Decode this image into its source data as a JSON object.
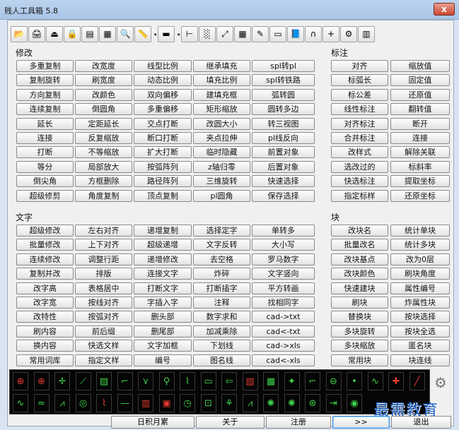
{
  "window": {
    "title": "贱人工具箱 5.8",
    "close_label": "x"
  },
  "toolbar": {
    "icons": [
      {
        "name": "open-folder-icon",
        "glyph": "📂"
      },
      {
        "name": "printer-icon",
        "glyph": "🖨"
      },
      {
        "name": "export-icon",
        "glyph": "⏏"
      },
      {
        "name": "lock-icon",
        "glyph": "🔒"
      },
      {
        "name": "plot-icon",
        "glyph": "▤"
      },
      {
        "name": "document-icon",
        "glyph": "▦"
      },
      {
        "name": "zoom-icon",
        "glyph": "🔍"
      },
      {
        "name": "ruler-icon",
        "glyph": "📏"
      },
      {
        "name": "arrow-left-icon",
        "glyph": "◂"
      },
      {
        "name": "layer-icon",
        "glyph": "▬"
      },
      {
        "name": "arrow-left-2-icon",
        "glyph": "◂"
      },
      {
        "name": "tree-icon",
        "glyph": "⊢"
      },
      {
        "name": "gradient-icon",
        "glyph": "░"
      },
      {
        "name": "resize-icon",
        "glyph": "⤢"
      },
      {
        "name": "color-palette-icon",
        "glyph": "▦"
      },
      {
        "name": "edit-doc-icon",
        "glyph": "✎"
      },
      {
        "name": "monitor-icon",
        "glyph": "▭"
      },
      {
        "name": "book-icon",
        "glyph": "📘"
      },
      {
        "name": "magnet-icon",
        "glyph": "∩"
      },
      {
        "name": "crosshair-icon",
        "glyph": "+"
      },
      {
        "name": "plugin-icon",
        "glyph": "⚙"
      },
      {
        "name": "calculator-icon",
        "glyph": "▥"
      }
    ]
  },
  "sections": {
    "modify": "修改",
    "dimension": "标注",
    "text": "文字",
    "block": "块"
  },
  "modify_buttons": [
    [
      "多重复制",
      "改宽度",
      "线型比例",
      "继承填充",
      "spl转pl"
    ],
    [
      "复制旋转",
      "刷宽度",
      "动态比例",
      "填充比例",
      "spl转铁路"
    ],
    [
      "方向复制",
      "改颜色",
      "双向偏移",
      "建填充框",
      "弧转圆"
    ],
    [
      "连续复制",
      "倒圆角",
      "多重偏移",
      "矩形缩放",
      "圆转多边"
    ],
    [
      "延长",
      "定距延长",
      "交点打断",
      "改圆大小",
      "转三视图"
    ],
    [
      "连接",
      "反复缩放",
      "断口打断",
      "夹点拉伸",
      "pl线反向"
    ],
    [
      "打断",
      "不等缩放",
      "扩大打断",
      "临时隐藏",
      "前置对象"
    ],
    [
      "等分",
      "局部放大",
      "按弧阵列",
      "z轴归零",
      "后置对象"
    ],
    [
      "倒尖角",
      "方框删除",
      "路径阵列",
      "三维旋转",
      "快速选择"
    ],
    [
      "超级修剪",
      "角度复制",
      "顶点复制",
      "pl圆角",
      "保存选择"
    ]
  ],
  "dimension_buttons": [
    [
      "对齐",
      "缩放值"
    ],
    [
      "标弧长",
      "固定值"
    ],
    [
      "标公差",
      "还原值"
    ],
    [
      "线性标注",
      "翻转值"
    ],
    [
      "对齐标注",
      "断开"
    ],
    [
      "合并标注",
      "连接"
    ],
    [
      "改样式",
      "解除关联"
    ],
    [
      "选改过的",
      "标斜率"
    ],
    [
      "快选标注",
      "提取坐标"
    ],
    [
      "指定标样",
      "还原坐标"
    ]
  ],
  "text_buttons": [
    [
      "超级修改",
      "左右对齐",
      "递增复制",
      "选择定字",
      "单转多"
    ],
    [
      "批量修改",
      "上下对齐",
      "超级递增",
      "文字反转",
      "大小写"
    ],
    [
      "连续修改",
      "调整行距",
      "递增修改",
      "去空格",
      "罗马数字"
    ],
    [
      "复制并改",
      "排版",
      "连接文字",
      "炸碎",
      "文字竖向"
    ],
    [
      "改字高",
      "表格居中",
      "打断文字",
      "打断插字",
      "平方转画"
    ],
    [
      "改字宽",
      "按线对齐",
      "字插入字",
      "注释",
      "找相同字"
    ],
    [
      "改特性",
      "按弧对齐",
      "删头部",
      "数字求和",
      "cad->txt"
    ],
    [
      "刷内容",
      "前后缀",
      "删尾部",
      "加减乘除",
      "cad<-txt"
    ],
    [
      "换内容",
      "快选文样",
      "文字加框",
      "下划线",
      "cad->xls"
    ],
    [
      "常用词库",
      "指定文样",
      "编号",
      "图名线",
      "cad<-xls"
    ]
  ],
  "block_buttons": [
    [
      "改块名",
      "统计单块"
    ],
    [
      "批量改名",
      "统计多块"
    ],
    [
      "改块基点",
      "改为0层"
    ],
    [
      "改块颜色",
      "刷块角度"
    ],
    [
      "快速建块",
      "属性编号"
    ],
    [
      "刷块",
      "炸属性块"
    ],
    [
      "替换块",
      "按块选择"
    ],
    [
      "多块旋转",
      "按块全选"
    ],
    [
      "多块缩放",
      "匿名块"
    ],
    [
      "常用块",
      "块连线"
    ]
  ],
  "icon_tray": {
    "row1": [
      {
        "name": "target-red-icon",
        "glyph": "⊕",
        "color": "#e03a2e"
      },
      {
        "name": "target-red-2-icon",
        "glyph": "⊕",
        "color": "#e03a2e"
      },
      {
        "name": "arrow-cross-icon",
        "glyph": "✛",
        "color": "#3fd24a"
      },
      {
        "name": "slash-arrow-icon",
        "glyph": "⟋",
        "color": "#3fd24a"
      },
      {
        "name": "hatch-icon",
        "glyph": "▨",
        "color": "#3fd24a"
      },
      {
        "name": "bracket-icon",
        "glyph": "⌐",
        "color": "#3fd24a"
      },
      {
        "name": "tree-branch-icon",
        "glyph": "⋎",
        "color": "#3fd24a"
      },
      {
        "name": "anchor-icon",
        "glyph": "⚲",
        "color": "#3fd24a"
      },
      {
        "name": "wave-box-icon",
        "glyph": "⌇",
        "color": "#3fd24a"
      },
      {
        "name": "speech-icon",
        "glyph": "▭",
        "color": "#3fd24a"
      },
      {
        "name": "arrow-back-icon",
        "glyph": "⇦",
        "color": "#3fd24a"
      },
      {
        "name": "chart-box-icon",
        "glyph": "▧",
        "color": "#e03a2e"
      },
      {
        "name": "grid-table-icon",
        "glyph": "▦",
        "color": "#3fd24a"
      },
      {
        "name": "star-icon",
        "glyph": "✦",
        "color": "#3fd24a"
      },
      {
        "name": "stairs-icon",
        "glyph": "⌐",
        "color": "#3fd24a"
      },
      {
        "name": "circle-line-icon",
        "glyph": "⊖",
        "color": "#3fd24a"
      },
      {
        "name": "dot-icon",
        "glyph": "•",
        "color": "#3fd24a"
      },
      {
        "name": "wave-line-icon",
        "glyph": "∿",
        "color": "#3fd24a"
      },
      {
        "name": "cross-red-icon",
        "glyph": "✚",
        "color": "#e03a2e"
      },
      {
        "name": "diagonal-line-icon",
        "glyph": "╱",
        "color": "#e03a2e"
      }
    ],
    "row2": [
      {
        "name": "spring-icon",
        "glyph": "∿",
        "color": "#3fd24a"
      },
      {
        "name": "wave-icon",
        "glyph": "≈",
        "color": "#3fd24a"
      },
      {
        "name": "zigzag-icon",
        "glyph": "⩘",
        "color": "#3fd24a"
      },
      {
        "name": "concentric-icon",
        "glyph": "◎",
        "color": "#3fd24a"
      },
      {
        "name": "bolt-red-icon",
        "glyph": "⌇",
        "color": "#e03a2e"
      },
      {
        "name": "line-icon",
        "glyph": "—",
        "color": "#3fd24a"
      },
      {
        "name": "stripes-icon",
        "glyph": "▥",
        "color": "#e03a2e"
      },
      {
        "name": "square-red-icon",
        "glyph": "▣",
        "color": "#e03a2e"
      },
      {
        "name": "clock-icon",
        "glyph": "◷",
        "color": "#3fd24a"
      },
      {
        "name": "square-dot-icon",
        "glyph": "⊡",
        "color": "#3fd24a"
      },
      {
        "name": "plant-icon",
        "glyph": "⚘",
        "color": "#3fd24a"
      },
      {
        "name": "signal-icon",
        "glyph": "⩘",
        "color": "#3fd24a"
      },
      {
        "name": "gear-small-icon",
        "glyph": "✺",
        "color": "#3fd24a"
      },
      {
        "name": "gear-small-2-icon",
        "glyph": "✺",
        "color": "#3fd24a"
      },
      {
        "name": "circle-grid-icon",
        "glyph": "⊛",
        "color": "#3fd24a"
      },
      {
        "name": "arrow-right-line-icon",
        "glyph": "⇥",
        "color": "#3fd24a"
      },
      {
        "name": "spiral-icon",
        "glyph": "◉",
        "color": "#3fd24a"
      }
    ]
  },
  "settings_icon": "⚙",
  "watermark": "最需教育",
  "bottom_buttons": [
    "日积月累",
    "关于",
    "注册",
    ">>",
    "退出"
  ]
}
